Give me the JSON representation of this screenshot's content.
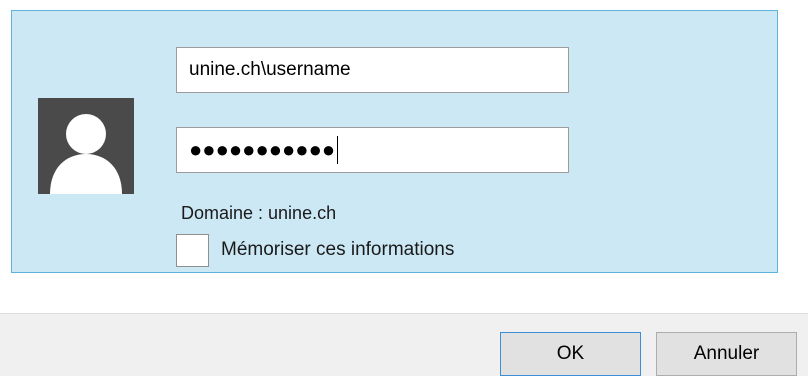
{
  "credentials": {
    "username_value": "unine.ch\\username",
    "password_mask": "●●●●●●●●●●●",
    "domain_text": "Domaine : unine.ch",
    "remember_label": "Mémoriser ces informations",
    "remember_checked": false,
    "avatar_icon": "user-silhouette-icon"
  },
  "buttons": {
    "ok_label": "OK",
    "cancel_label": "Annuler"
  },
  "colors": {
    "panel_background": "#cce8f5",
    "panel_border": "#5fb3dd",
    "avatar_background": "#4a4a4a",
    "ok_border": "#3c8fd6"
  }
}
